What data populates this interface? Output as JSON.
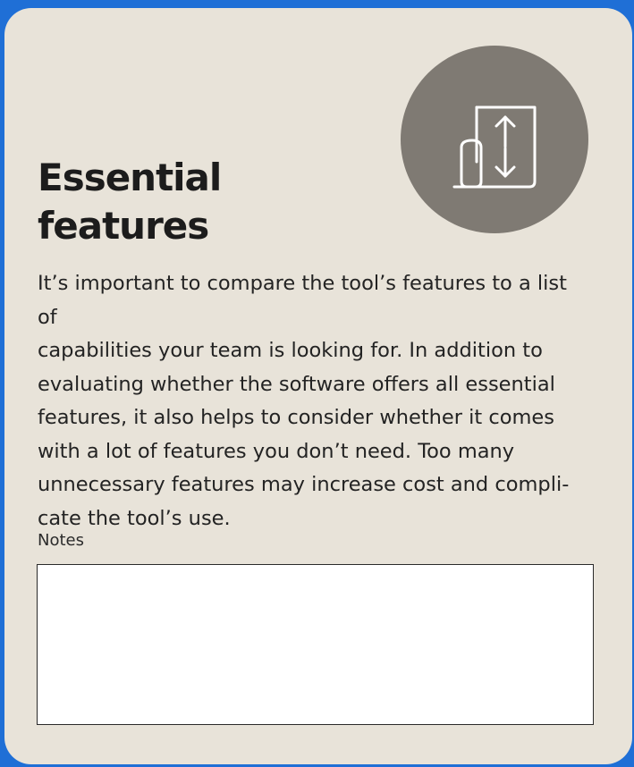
{
  "card": {
    "title": "Essential\nfeatures",
    "icon": "document-arrows-icon",
    "body": "It’s important to compare the tool’s features to a list of\ncapabilities your team is looking for. In addition to\nevaluating whether the software offers all essential\nfeatures, it also helps to consider whether it comes\nwith a lot of features you don’t need. Too many\nunnecessary features may increase cost and compli-\ncate the tool’s use.",
    "notes_label": "Notes",
    "notes_value": ""
  },
  "colors": {
    "frame": "#1f6fd6",
    "card_background": "#e8e3d9",
    "icon_circle": "#7f7a73",
    "text": "#1c1c1c"
  }
}
